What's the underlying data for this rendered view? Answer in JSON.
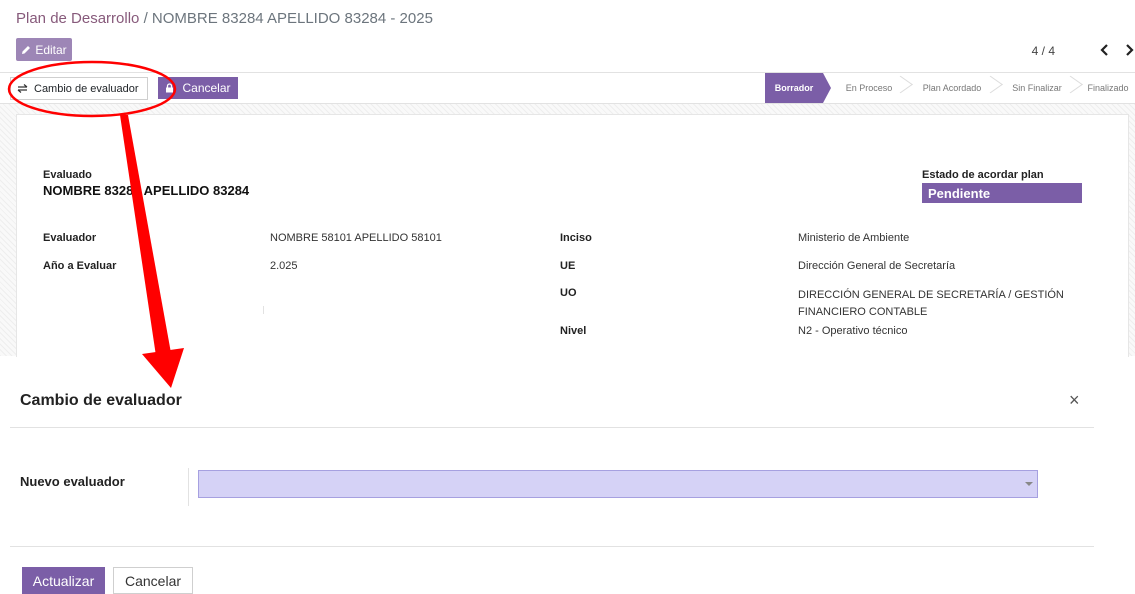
{
  "breadcrumb": {
    "parent": "Plan de Desarrollo",
    "separator": " / ",
    "current": "NOMBRE 83284 APELLIDO 83284 - 2025"
  },
  "toolbar": {
    "edit_label": "Editar",
    "pager": "4 / 4"
  },
  "statusbar": {
    "change_label": "Cambio de evaluador",
    "cancel_label": "Cancelar",
    "stages": [
      "Borrador",
      "En Proceso",
      "Plan Acordado",
      "Sin Finalizar",
      "Finalizado"
    ],
    "active_stage": "Borrador"
  },
  "sheet": {
    "evaluado_label": "Evaluado",
    "evaluado_value": "NOMBRE 83284 APELLIDO 83284",
    "estado_label": "Estado de acordar plan",
    "estado_value": "Pendiente",
    "evaluador_label": "Evaluador",
    "evaluador_value": "NOMBRE 58101 APELLIDO 58101",
    "anio_label": "Año a Evaluar",
    "anio_value": "2.025",
    "inciso_label": "Inciso",
    "inciso_value": "Ministerio de Ambiente",
    "ue_label": "UE",
    "ue_value": "Dirección General de Secretaría",
    "uo_label": "UO",
    "uo_value": "DIRECCIÓN GENERAL DE SECRETARÍA / GESTIÓN FINANCIERO CONTABLE",
    "nivel_label": "Nivel",
    "nivel_value": "N2 - Operativo técnico"
  },
  "modal": {
    "title": "Cambio de evaluador",
    "field_label": "Nuevo evaluador",
    "select_value": "",
    "update_label": "Actualizar",
    "cancel_label": "Cancelar"
  },
  "colors": {
    "primary": "#7b5ea7",
    "select_bg": "#d5d2f6",
    "annotation": "#ff0000"
  }
}
